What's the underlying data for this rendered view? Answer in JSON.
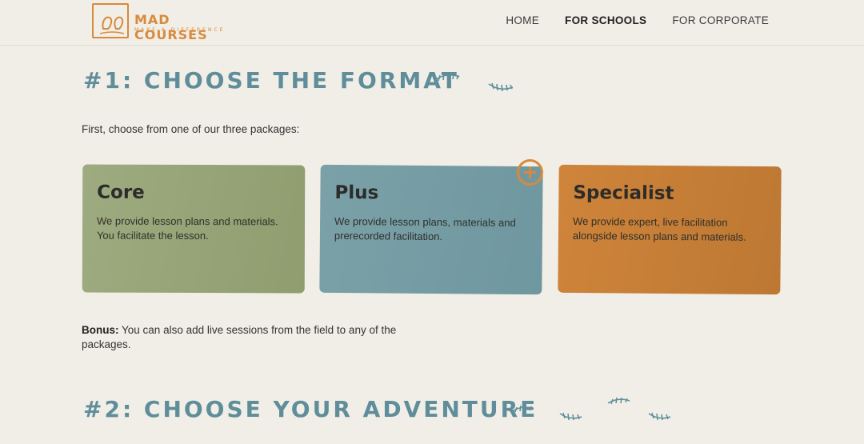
{
  "brand": {
    "name": "MAD COURSES",
    "tagline": "MAKE A DIFFERENCE",
    "color": "#d88a3c"
  },
  "nav": {
    "items": [
      {
        "label": "HOME"
      },
      {
        "label": "FOR SCHOOLS"
      },
      {
        "label": "FOR CORPORATE"
      }
    ]
  },
  "section1": {
    "heading": "#1: CHOOSE THE FORMAT",
    "intro": "First, choose from one of our three packages:",
    "cards": [
      {
        "title": "Core",
        "text": "We provide lesson plans and materials. You facilitate the lesson.",
        "color": "#9aa77b"
      },
      {
        "title": "Plus",
        "text": "We provide lesson plans, materials and prerecorded facilitation.",
        "color": "#749ba3"
      },
      {
        "title": "Specialist",
        "text": "We provide expert, live facilitation alongside lesson plans and materials.",
        "color": "#c77e36"
      }
    ],
    "bonus_label": "Bonus:",
    "bonus_text": "You can also add live sessions from the field to any of the packages."
  },
  "section2": {
    "heading": "#2: CHOOSE YOUR ADVENTURE"
  },
  "accent_color": "#5f8e9a"
}
